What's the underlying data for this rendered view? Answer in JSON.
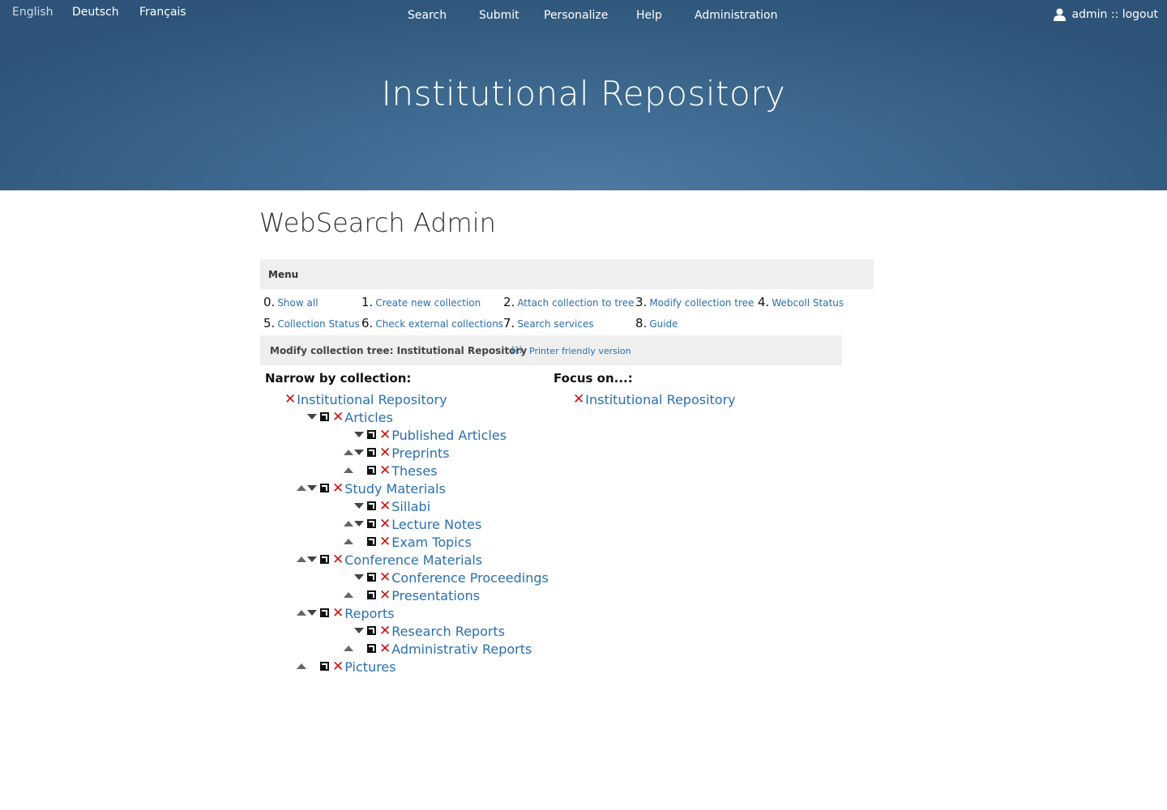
{
  "header": {
    "languages": [
      "English",
      "Deutsch",
      "Français"
    ],
    "nav": [
      "Search",
      "Submit",
      "Personalize",
      "Help",
      "Administration"
    ],
    "user": "admin :: logout",
    "site_title": "Institutional Repository"
  },
  "page_title": "WebSearch Admin",
  "menu": {
    "title": "Menu",
    "items": [
      {
        "num": "0.",
        "label": "Show all"
      },
      {
        "num": "1.",
        "label": "Create new collection"
      },
      {
        "num": "2.",
        "label": "Attach collection to tree"
      },
      {
        "num": "3.",
        "label": "Modify collection tree"
      },
      {
        "num": "4.",
        "label": "Webcoll Status"
      },
      {
        "num": "5.",
        "label": "Collection Status"
      },
      {
        "num": "6.",
        "label": "Check external collections"
      },
      {
        "num": "7.",
        "label": "Search services"
      },
      {
        "num": "8.",
        "label": "Guide"
      }
    ]
  },
  "modify": {
    "title": "Modify collection tree: Institutional Repository",
    "help": "[?]",
    "printer": "Printer friendly version"
  },
  "narrow": {
    "heading": "Narrow by collection:",
    "tree": [
      {
        "label": "Institutional Repository",
        "level": 0,
        "up": false,
        "down": false
      },
      {
        "label": "Articles",
        "level": 1,
        "up": false,
        "down": true
      },
      {
        "label": "Published Articles",
        "level": 2,
        "up": false,
        "down": true
      },
      {
        "label": "Preprints",
        "level": 2,
        "up": true,
        "down": true
      },
      {
        "label": "Theses",
        "level": 2,
        "up": true,
        "down": false
      },
      {
        "label": "Study Materials",
        "level": 1,
        "up": true,
        "down": true
      },
      {
        "label": "Sillabi",
        "level": 2,
        "up": false,
        "down": true
      },
      {
        "label": "Lecture Notes",
        "level": 2,
        "up": true,
        "down": true
      },
      {
        "label": "Exam Topics",
        "level": 2,
        "up": true,
        "down": false
      },
      {
        "label": "Conference Materials",
        "level": 1,
        "up": true,
        "down": true
      },
      {
        "label": "Conference Proceedings",
        "level": 2,
        "up": false,
        "down": true
      },
      {
        "label": "Presentations",
        "level": 2,
        "up": true,
        "down": false
      },
      {
        "label": "Reports",
        "level": 1,
        "up": true,
        "down": true
      },
      {
        "label": "Research Reports",
        "level": 2,
        "up": false,
        "down": true
      },
      {
        "label": "Administrativ Reports",
        "level": 2,
        "up": true,
        "down": false
      },
      {
        "label": "Pictures",
        "level": 1,
        "up": true,
        "down": false
      }
    ]
  },
  "focus": {
    "heading": "Focus on...:",
    "tree": [
      {
        "label": "Institutional Repository"
      }
    ]
  },
  "colors": {
    "link": "#2a6fb0",
    "delete": "#cc1111",
    "header_bg": "#3f6b92"
  }
}
